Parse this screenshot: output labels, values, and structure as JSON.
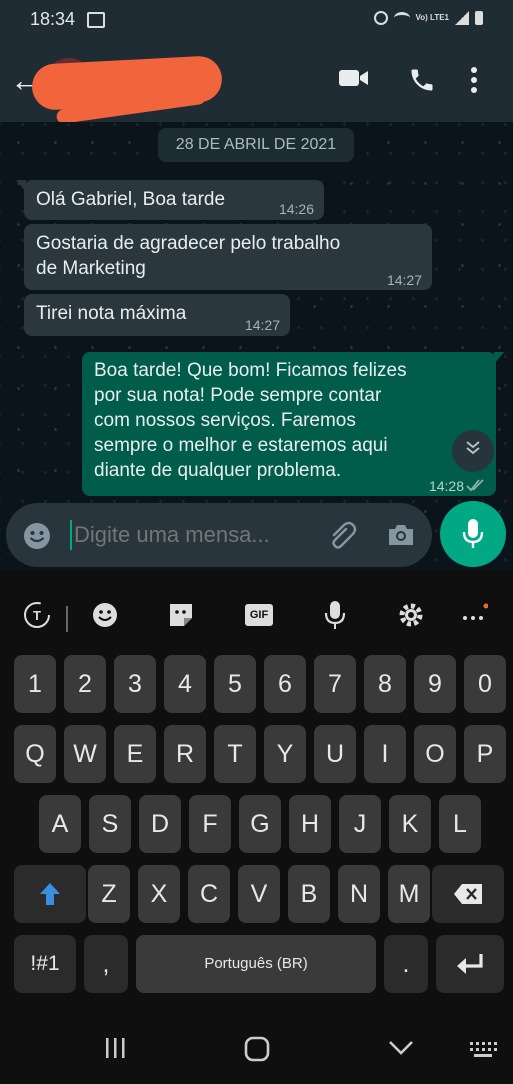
{
  "status_bar": {
    "time": "18:34",
    "network_label": "Vo) LTE1"
  },
  "app_bar": {
    "back_icon": "arrow-left-icon",
    "video_icon": "video-call-icon",
    "call_icon": "phone-icon",
    "menu_icon": "more-vertical-icon"
  },
  "chat": {
    "date": "28 DE ABRIL DE 2021",
    "messages": [
      {
        "direction": "in",
        "text_lines": [
          "Olá Gabriel, Boa tarde"
        ],
        "time": "14:26"
      },
      {
        "direction": "in",
        "text_lines": [
          "Gostaria de agradecer pelo trabalho",
          "de Marketing"
        ],
        "time": "14:27"
      },
      {
        "direction": "in",
        "text_lines": [
          "Tirei nota máxima"
        ],
        "time": "14:27"
      },
      {
        "direction": "out",
        "text_lines": [
          "Boa tarde! Que bom! Ficamos felizes",
          "por sua nota! Pode sempre contar",
          "com nossos serviços. Faremos",
          "sempre o melhor e estaremos aqui",
          "diante de qualquer problema."
        ],
        "time": "14:28",
        "status": "read"
      }
    ]
  },
  "composer": {
    "placeholder": "Digite uma mensa..."
  },
  "keyboard": {
    "number_row": [
      "1",
      "2",
      "3",
      "4",
      "5",
      "6",
      "7",
      "8",
      "9",
      "0"
    ],
    "row1": [
      "Q",
      "W",
      "E",
      "R",
      "T",
      "Y",
      "U",
      "I",
      "O",
      "P"
    ],
    "row2": [
      "A",
      "S",
      "D",
      "F",
      "G",
      "H",
      "J",
      "K",
      "L"
    ],
    "row3": [
      "Z",
      "X",
      "C",
      "V",
      "B",
      "N",
      "M"
    ],
    "symbols_key": "!#1",
    "comma_key": ",",
    "space_label": "Português (BR)",
    "period_key": ".",
    "toolbar": {
      "gif_label": "GIF"
    }
  },
  "colors": {
    "outgoing_bubble": "#005c4b",
    "incoming_bubble": "#2a373d",
    "accent": "#00a884",
    "header": "#1f2c34"
  }
}
